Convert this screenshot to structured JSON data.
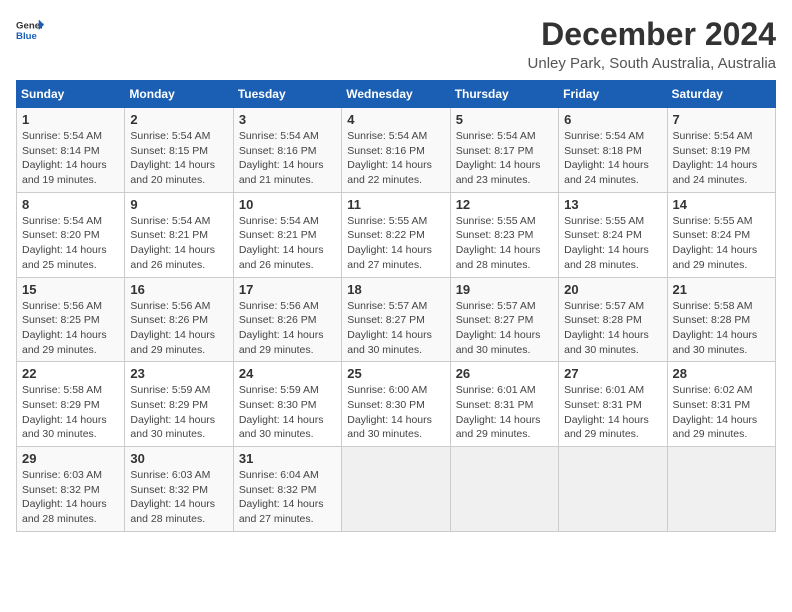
{
  "header": {
    "logo": {
      "general": "General",
      "blue": "Blue"
    },
    "title": "December 2024",
    "location": "Unley Park, South Australia, Australia"
  },
  "weekdays": [
    "Sunday",
    "Monday",
    "Tuesday",
    "Wednesday",
    "Thursday",
    "Friday",
    "Saturday"
  ],
  "weeks": [
    [
      {
        "day": "1",
        "sunrise": "5:54 AM",
        "sunset": "8:14 PM",
        "daylight": "14 hours and 19 minutes."
      },
      {
        "day": "2",
        "sunrise": "5:54 AM",
        "sunset": "8:15 PM",
        "daylight": "14 hours and 20 minutes."
      },
      {
        "day": "3",
        "sunrise": "5:54 AM",
        "sunset": "8:16 PM",
        "daylight": "14 hours and 21 minutes."
      },
      {
        "day": "4",
        "sunrise": "5:54 AM",
        "sunset": "8:16 PM",
        "daylight": "14 hours and 22 minutes."
      },
      {
        "day": "5",
        "sunrise": "5:54 AM",
        "sunset": "8:17 PM",
        "daylight": "14 hours and 23 minutes."
      },
      {
        "day": "6",
        "sunrise": "5:54 AM",
        "sunset": "8:18 PM",
        "daylight": "14 hours and 24 minutes."
      },
      {
        "day": "7",
        "sunrise": "5:54 AM",
        "sunset": "8:19 PM",
        "daylight": "14 hours and 24 minutes."
      }
    ],
    [
      {
        "day": "8",
        "sunrise": "5:54 AM",
        "sunset": "8:20 PM",
        "daylight": "14 hours and 25 minutes."
      },
      {
        "day": "9",
        "sunrise": "5:54 AM",
        "sunset": "8:21 PM",
        "daylight": "14 hours and 26 minutes."
      },
      {
        "day": "10",
        "sunrise": "5:54 AM",
        "sunset": "8:21 PM",
        "daylight": "14 hours and 26 minutes."
      },
      {
        "day": "11",
        "sunrise": "5:55 AM",
        "sunset": "8:22 PM",
        "daylight": "14 hours and 27 minutes."
      },
      {
        "day": "12",
        "sunrise": "5:55 AM",
        "sunset": "8:23 PM",
        "daylight": "14 hours and 28 minutes."
      },
      {
        "day": "13",
        "sunrise": "5:55 AM",
        "sunset": "8:24 PM",
        "daylight": "14 hours and 28 minutes."
      },
      {
        "day": "14",
        "sunrise": "5:55 AM",
        "sunset": "8:24 PM",
        "daylight": "14 hours and 29 minutes."
      }
    ],
    [
      {
        "day": "15",
        "sunrise": "5:56 AM",
        "sunset": "8:25 PM",
        "daylight": "14 hours and 29 minutes."
      },
      {
        "day": "16",
        "sunrise": "5:56 AM",
        "sunset": "8:26 PM",
        "daylight": "14 hours and 29 minutes."
      },
      {
        "day": "17",
        "sunrise": "5:56 AM",
        "sunset": "8:26 PM",
        "daylight": "14 hours and 29 minutes."
      },
      {
        "day": "18",
        "sunrise": "5:57 AM",
        "sunset": "8:27 PM",
        "daylight": "14 hours and 30 minutes."
      },
      {
        "day": "19",
        "sunrise": "5:57 AM",
        "sunset": "8:27 PM",
        "daylight": "14 hours and 30 minutes."
      },
      {
        "day": "20",
        "sunrise": "5:57 AM",
        "sunset": "8:28 PM",
        "daylight": "14 hours and 30 minutes."
      },
      {
        "day": "21",
        "sunrise": "5:58 AM",
        "sunset": "8:28 PM",
        "daylight": "14 hours and 30 minutes."
      }
    ],
    [
      {
        "day": "22",
        "sunrise": "5:58 AM",
        "sunset": "8:29 PM",
        "daylight": "14 hours and 30 minutes."
      },
      {
        "day": "23",
        "sunrise": "5:59 AM",
        "sunset": "8:29 PM",
        "daylight": "14 hours and 30 minutes."
      },
      {
        "day": "24",
        "sunrise": "5:59 AM",
        "sunset": "8:30 PM",
        "daylight": "14 hours and 30 minutes."
      },
      {
        "day": "25",
        "sunrise": "6:00 AM",
        "sunset": "8:30 PM",
        "daylight": "14 hours and 30 minutes."
      },
      {
        "day": "26",
        "sunrise": "6:01 AM",
        "sunset": "8:31 PM",
        "daylight": "14 hours and 29 minutes."
      },
      {
        "day": "27",
        "sunrise": "6:01 AM",
        "sunset": "8:31 PM",
        "daylight": "14 hours and 29 minutes."
      },
      {
        "day": "28",
        "sunrise": "6:02 AM",
        "sunset": "8:31 PM",
        "daylight": "14 hours and 29 minutes."
      }
    ],
    [
      {
        "day": "29",
        "sunrise": "6:03 AM",
        "sunset": "8:32 PM",
        "daylight": "14 hours and 28 minutes."
      },
      {
        "day": "30",
        "sunrise": "6:03 AM",
        "sunset": "8:32 PM",
        "daylight": "14 hours and 28 minutes."
      },
      {
        "day": "31",
        "sunrise": "6:04 AM",
        "sunset": "8:32 PM",
        "daylight": "14 hours and 27 minutes."
      },
      null,
      null,
      null,
      null
    ]
  ],
  "labels": {
    "sunrise": "Sunrise:",
    "sunset": "Sunset:",
    "daylight": "Daylight:"
  }
}
